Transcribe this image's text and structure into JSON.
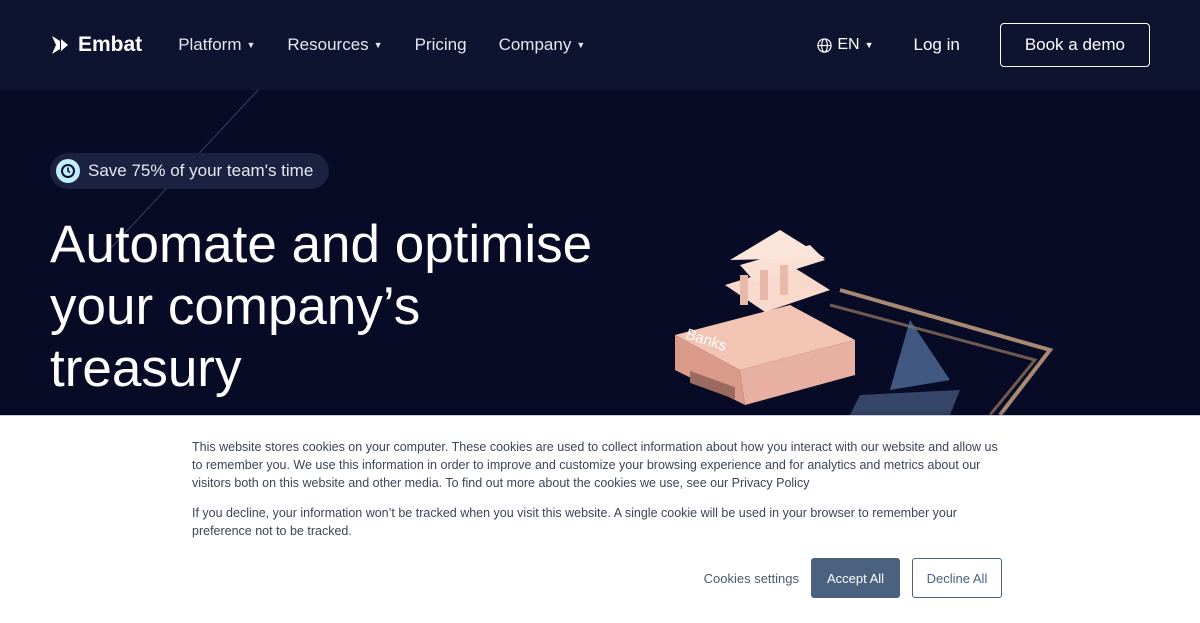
{
  "nav": {
    "brand": "Embat",
    "items": [
      {
        "label": "Platform",
        "dropdown": true
      },
      {
        "label": "Resources",
        "dropdown": true
      },
      {
        "label": "Pricing",
        "dropdown": false
      },
      {
        "label": "Company",
        "dropdown": true
      }
    ],
    "language": "EN",
    "login": "Log in",
    "cta": "Book a demo"
  },
  "hero": {
    "badge": "Save 75% of your team's time",
    "title": "Automate and optimise your company’s treasury",
    "illustration_label": "Banks"
  },
  "cookie": {
    "p1": "This website stores cookies on your computer. These cookies are used to collect information about how you interact with our website and allow us to remember you. We use this information in order to improve and customize your browsing experience and for analytics and metrics about our visitors both on this website and other media. To find out more about the cookies we use, see our Privacy Policy",
    "p2": "If you decline, your information won’t be tracked when you visit this website. A single cookie will be used in your browser to remember your preference not to be tracked.",
    "settings": "Cookies settings",
    "accept": "Accept All",
    "decline": "Decline All"
  },
  "colors": {
    "background": "#070b26",
    "accent": "#4a6280",
    "badge_icon": "#bfeefa"
  }
}
